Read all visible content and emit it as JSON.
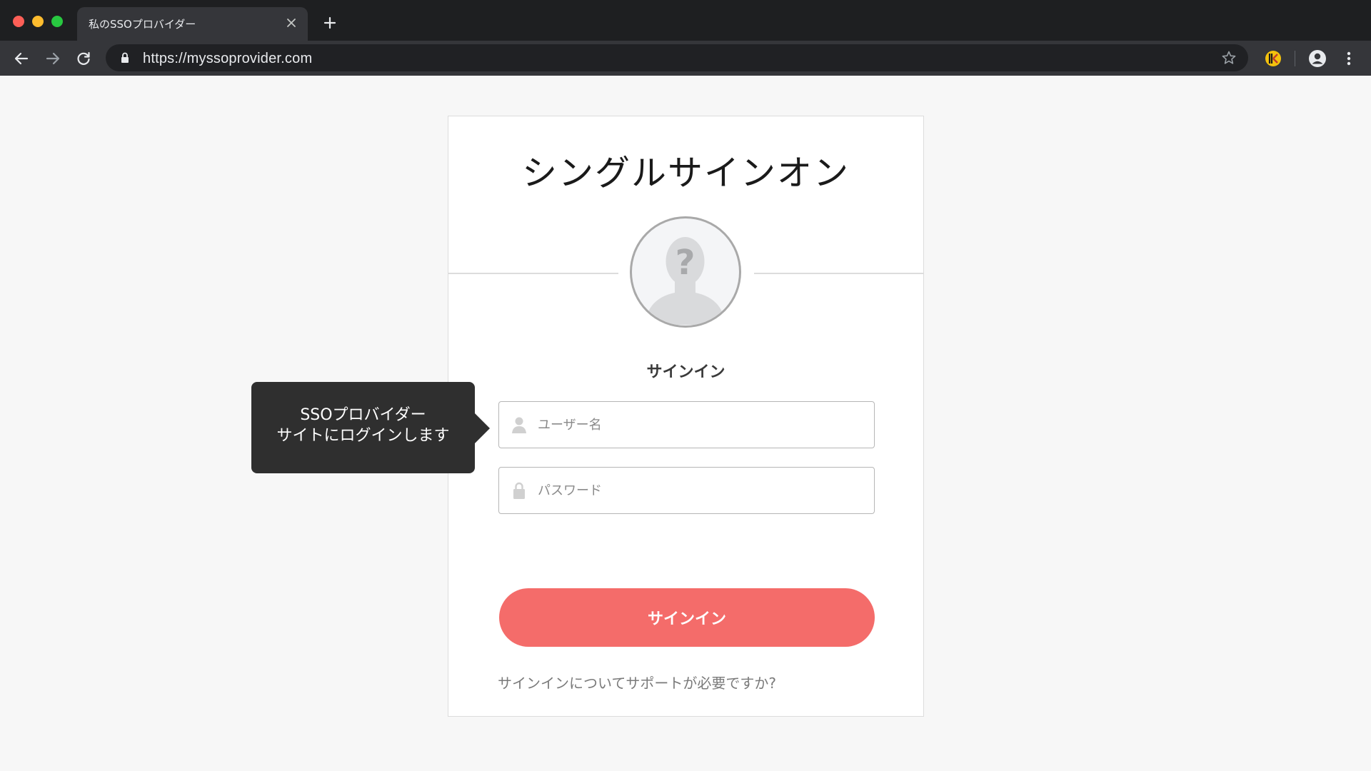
{
  "browser": {
    "tab_title": "私のSSOプロバイダー",
    "url": "https://myssoprovider.com",
    "icons": {
      "back": "back-arrow-icon",
      "forward": "forward-arrow-icon",
      "reload": "reload-icon",
      "lock": "lock-icon",
      "star": "bookmark-star-icon",
      "extension": "extension-icon",
      "profile": "profile-icon",
      "menu": "kebab-menu-icon",
      "close_tab": "close-icon",
      "new_tab": "plus-icon"
    }
  },
  "login": {
    "title": "シングルサインオン",
    "heading": "サインイン",
    "username_placeholder": "ユーザー名",
    "password_placeholder": "パスワード",
    "submit_label": "サインイン",
    "help_text": "サインインについてサポートが必要ですか?",
    "button_color": "#f46c6a",
    "icons": {
      "avatar": "unknown-user-avatar",
      "username": "user-icon",
      "password": "lock-icon"
    }
  },
  "tooltip": {
    "line1": "SSOプロバイダー",
    "line2": "サイトにログインします"
  }
}
